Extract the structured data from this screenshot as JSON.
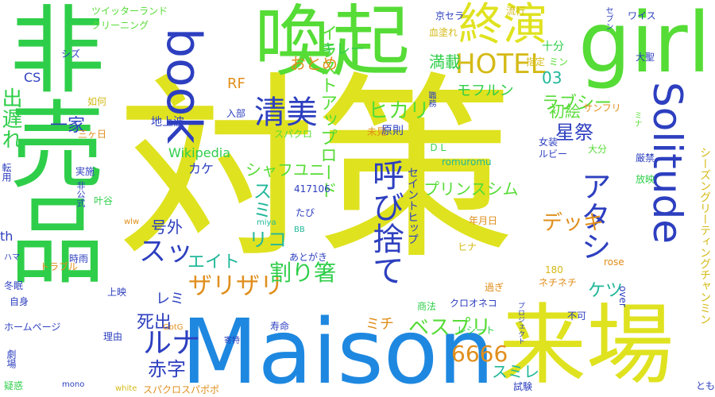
{
  "palette": {
    "yellow": "#dfe21f",
    "lime": "#56dc36",
    "green": "#2fce4a",
    "teal": "#22b89a",
    "blue": "#1e88e0",
    "navy": "#2d3fbf",
    "orange": "#e08e1b",
    "gold": "#d4ba16"
  },
  "words": [
    {
      "text": "対策",
      "color": "yellow"
    },
    {
      "text": "Maison",
      "color": "blue"
    },
    {
      "text": "喚起",
      "color": "lime"
    },
    {
      "text": "girl",
      "color": "lime"
    },
    {
      "text": "来場",
      "color": "yellow"
    },
    {
      "text": "非売品",
      "color": "green"
    },
    {
      "text": "book",
      "color": "navy"
    },
    {
      "text": "Solitude",
      "color": "navy"
    },
    {
      "text": "終演",
      "color": "yellow"
    },
    {
      "text": "HOTEL",
      "color": "gold"
    },
    {
      "text": "清美",
      "color": "navy"
    },
    {
      "text": "呼び捨て",
      "color": "navy"
    },
    {
      "text": "アタシ",
      "color": "navy"
    },
    {
      "text": "ルナ",
      "color": "navy"
    },
    {
      "text": "スッ",
      "color": "navy"
    },
    {
      "text": "イラストアップロード",
      "color": "lime"
    },
    {
      "text": "出遅れ",
      "color": "green"
    },
    {
      "text": "満載",
      "color": "green"
    },
    {
      "text": "ザリザリ",
      "color": "orange"
    },
    {
      "text": "ヒカリ",
      "color": "lime"
    },
    {
      "text": "ラブシー",
      "color": "lime"
    },
    {
      "text": "デッキ",
      "color": "orange"
    },
    {
      "text": "6666",
      "color": "orange"
    },
    {
      "text": "割り箸",
      "color": "green"
    },
    {
      "text": "ベスプリ",
      "color": "lime"
    },
    {
      "text": "赤字",
      "color": "navy"
    },
    {
      "text": "一家",
      "color": "navy"
    },
    {
      "text": "死出",
      "color": "navy"
    },
    {
      "text": "エイト",
      "color": "teal"
    },
    {
      "text": "リコ",
      "color": "teal"
    },
    {
      "text": "スミ",
      "color": "teal"
    },
    {
      "text": "スミレ",
      "color": "teal"
    },
    {
      "text": "シャフユニ",
      "color": "lime"
    },
    {
      "text": "プリンスシム",
      "color": "lime"
    },
    {
      "text": "ケツ",
      "color": "teal"
    },
    {
      "text": "星祭",
      "color": "navy"
    },
    {
      "text": "初絵",
      "color": "lime"
    },
    {
      "text": "モフルン",
      "color": "green"
    },
    {
      "text": "キレー",
      "color": "green"
    },
    {
      "text": "おとめ",
      "color": "orange"
    },
    {
      "text": "03",
      "color": "teal"
    },
    {
      "text": "十分",
      "color": "green"
    },
    {
      "text": "号外",
      "color": "navy"
    },
    {
      "text": "ミチ",
      "color": "orange"
    },
    {
      "text": "レミ",
      "color": "navy"
    },
    {
      "text": "カケ",
      "color": "navy"
    },
    {
      "text": "Wikipedia",
      "color": "green"
    },
    {
      "text": "RF",
      "color": "orange"
    },
    {
      "text": "CS",
      "color": "navy"
    },
    {
      "text": "th",
      "color": "navy"
    },
    {
      "text": "シズ",
      "color": "navy"
    },
    {
      "text": "如何",
      "color": "gold"
    },
    {
      "text": "実施",
      "color": "navy"
    },
    {
      "text": "叶谷",
      "color": "green"
    },
    {
      "text": "転用",
      "color": "navy"
    },
    {
      "text": "三ヶ日",
      "color": "orange"
    },
    {
      "text": "地上波",
      "color": "navy"
    },
    {
      "text": "未見",
      "color": "orange"
    },
    {
      "text": "原則",
      "color": "navy"
    },
    {
      "text": "スパクロ",
      "color": "lime"
    },
    {
      "text": "入部",
      "color": "navy"
    },
    {
      "text": "ＤＬ",
      "color": "green"
    },
    {
      "text": "女装",
      "color": "navy"
    },
    {
      "text": "ルビー",
      "color": "navy"
    },
    {
      "text": "大分",
      "color": "lime"
    },
    {
      "text": "厳禁",
      "color": "navy"
    },
    {
      "text": "放映",
      "color": "green"
    },
    {
      "text": "ツイッターランド",
      "color": "lime"
    },
    {
      "text": "クリーニング",
      "color": "lime"
    },
    {
      "text": "血塗れ",
      "color": "gold"
    },
    {
      "text": "京セラ",
      "color": "navy"
    },
    {
      "text": "流行",
      "color": "gold"
    },
    {
      "text": "ワイス",
      "color": "navy"
    },
    {
      "text": "指定",
      "color": "gold"
    },
    {
      "text": "ミン",
      "color": "lime"
    },
    {
      "text": "大聖",
      "color": "navy"
    },
    {
      "text": "サンフリ",
      "color": "orange"
    },
    {
      "text": "セブン",
      "color": "navy"
    },
    {
      "text": "ミナ",
      "color": "lime"
    },
    {
      "text": "romuromu",
      "color": "teal"
    },
    {
      "text": "417106",
      "color": "navy"
    },
    {
      "text": "セイントヒップ",
      "color": "navy"
    },
    {
      "text": "シーズングリーティングチャンミン",
      "color": "gold"
    },
    {
      "text": "年月日",
      "color": "orange"
    },
    {
      "text": "ヒナ",
      "color": "gold"
    },
    {
      "text": "rose",
      "color": "orange"
    },
    {
      "text": "over",
      "color": "navy"
    },
    {
      "text": "180",
      "color": "gold"
    },
    {
      "text": "ネチネチ",
      "color": "orange"
    },
    {
      "text": "過ぎ",
      "color": "orange"
    },
    {
      "text": "クロオネコ",
      "color": "navy"
    },
    {
      "text": "レシート",
      "color": "green"
    },
    {
      "text": "商法",
      "color": "green"
    },
    {
      "text": "プロジェクト",
      "color": "navy"
    },
    {
      "text": "不可",
      "color": "navy"
    },
    {
      "text": "寿命",
      "color": "navy"
    },
    {
      "text": "とも",
      "color": "navy"
    },
    {
      "text": "試験",
      "color": "navy"
    },
    {
      "text": "スパクロスパポポ",
      "color": "orange"
    },
    {
      "text": "white",
      "color": "gold"
    },
    {
      "text": "mono",
      "color": "navy"
    },
    {
      "text": "疑惑",
      "color": "green"
    },
    {
      "text": "劇場",
      "color": "navy"
    },
    {
      "text": "理由",
      "color": "navy"
    },
    {
      "text": "寄特",
      "color": "navy"
    },
    {
      "text": "GotG",
      "color": "orange"
    },
    {
      "text": "ホームページ",
      "color": "navy"
    },
    {
      "text": "自身",
      "color": "navy"
    },
    {
      "text": "冬眠",
      "color": "navy"
    },
    {
      "text": "ハマ",
      "color": "navy"
    },
    {
      "text": "上映",
      "color": "navy"
    },
    {
      "text": "時雨",
      "color": "navy"
    },
    {
      "text": "トラブル",
      "color": "orange"
    },
    {
      "text": "あとがき",
      "color": "navy"
    },
    {
      "text": "miya",
      "color": "teal"
    },
    {
      "text": "BB",
      "color": "teal"
    },
    {
      "text": "wlw",
      "color": "orange"
    },
    {
      "text": "たび",
      "color": "navy"
    },
    {
      "text": "非公式",
      "color": "navy"
    },
    {
      "text": "職務",
      "color": "navy"
    }
  ]
}
